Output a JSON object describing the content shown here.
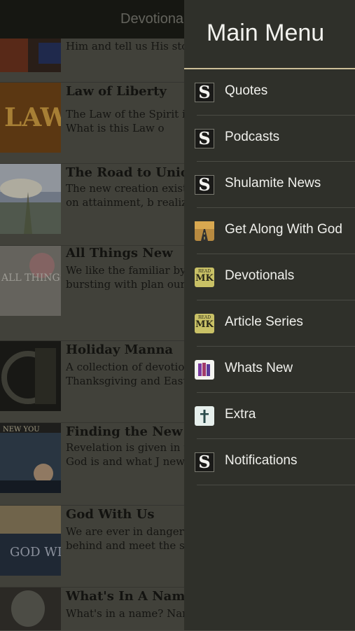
{
  "header": {
    "title": "Devotionals"
  },
  "articles": [
    {
      "title": "",
      "text": "Him and tell us His sto mystery of discipleship"
    },
    {
      "title": "Law of Liberty",
      "text": "The Law of the Spirit is method that you must you. What is this Law o"
    },
    {
      "title": "The Road to Unio",
      "text": "The new creation exist the Father—a fact. Yet based on attainment, b realization."
    },
    {
      "title": "All Things New",
      "text": "We like the familiar by God is the Creator, exp and bursting with plan our dreams. Are we rea new?"
    },
    {
      "title": "Holiday Manna",
      "text": "A collection of devotio various holidays, such Thanksgiving and East bless you!"
    },
    {
      "title": "Finding the New Y",
      "text": "Revelation is given in t life experience is burie who God is and what J new YOU."
    },
    {
      "title": "God With Us",
      "text": "We are ever in danger Himself for our idea of behind and meet the s with Us!"
    },
    {
      "title": "What's In A Nam",
      "text": "What's in a name? Nar serve to distinguish on"
    }
  ],
  "thumb_text": {
    "law": "LAW",
    "all_things_new": "ALL THINGS NEW",
    "finding": "NEW YOU",
    "god_with_us": "GOD WITH US"
  },
  "menu": {
    "title": "Main Menu",
    "items": [
      {
        "label": "Quotes",
        "icon": "shulamite-s-icon"
      },
      {
        "label": "Podcasts",
        "icon": "shulamite-s-icon"
      },
      {
        "label": "Shulamite News",
        "icon": "shulamite-s-icon"
      },
      {
        "label": "Get Along With God",
        "icon": "road-icon"
      },
      {
        "label": "Devotionals",
        "icon": "read-mk-icon"
      },
      {
        "label": "Article Series",
        "icon": "read-mk-icon"
      },
      {
        "label": "Whats New",
        "icon": "books-icon"
      },
      {
        "label": "Extra",
        "icon": "cross-icon"
      },
      {
        "label": "Notifications",
        "icon": "shulamite-s-icon"
      }
    ],
    "icon_glyphs": {
      "s": "S",
      "mk_top": "READ",
      "mk": "MK"
    }
  },
  "colors": {
    "drawer_bg": "#2f302a",
    "accent_rule": "#cdbf98",
    "read_mk_icon": "#c9c166"
  }
}
